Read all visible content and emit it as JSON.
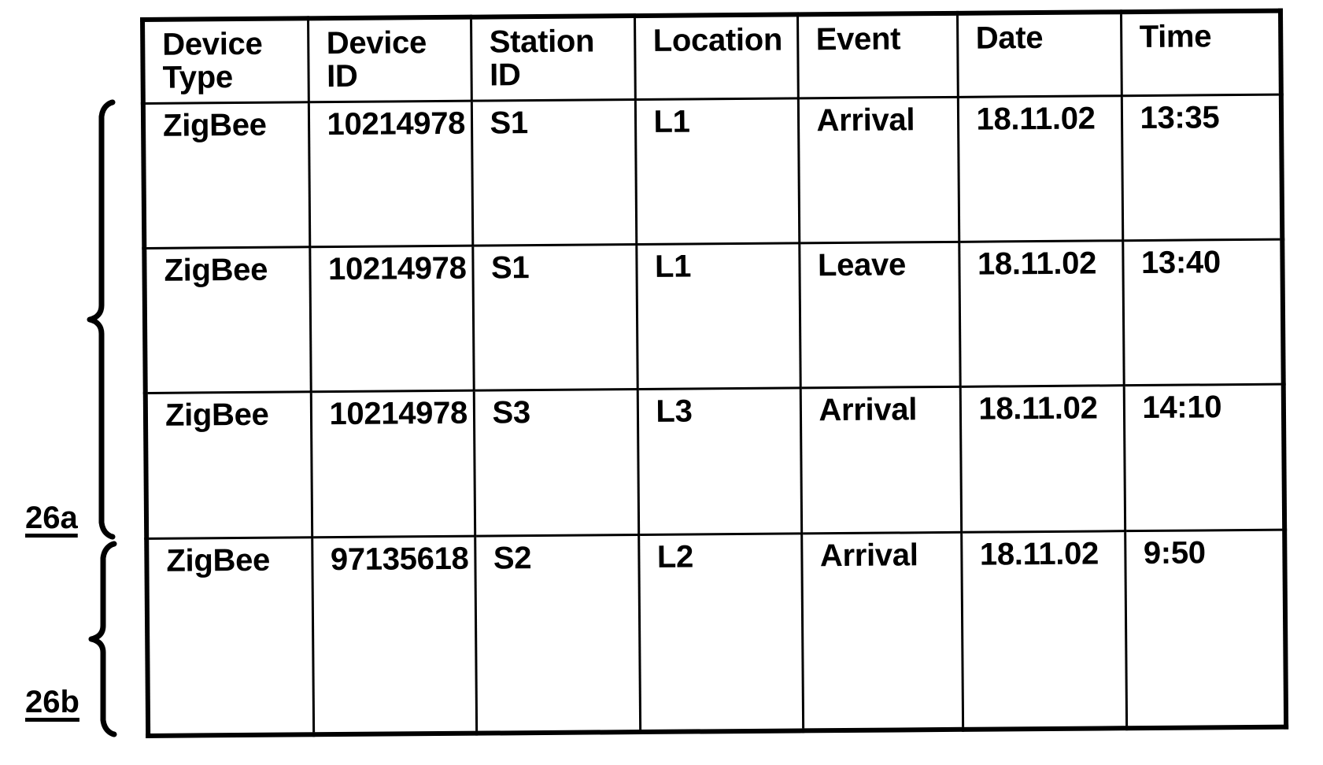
{
  "figure": {
    "caption_labels": [
      {
        "id": "26a",
        "text": "26a",
        "spans_rows": [
          0,
          1,
          2
        ]
      },
      {
        "id": "26b",
        "text": "26b",
        "spans_rows": [
          3
        ]
      }
    ]
  },
  "table": {
    "name": "device-event-log-table",
    "columns": [
      {
        "key": "device_type",
        "line1": "Device",
        "line2": "Type"
      },
      {
        "key": "device_id",
        "line1": "Device",
        "line2": "ID"
      },
      {
        "key": "station_id",
        "line1": "Station",
        "line2": "ID"
      },
      {
        "key": "location",
        "line1": "Location",
        "line2": ""
      },
      {
        "key": "event",
        "line1": "Event",
        "line2": ""
      },
      {
        "key": "date",
        "line1": "Date",
        "line2": ""
      },
      {
        "key": "time",
        "line1": "Time",
        "line2": ""
      }
    ],
    "rows": [
      {
        "device_type": "ZigBee",
        "device_id": "10214978",
        "station_id": "S1",
        "location": "L1",
        "event": "Arrival",
        "date": "18.11.02",
        "time": "13:35"
      },
      {
        "device_type": "ZigBee",
        "device_id": "10214978",
        "station_id": "S1",
        "location": "L1",
        "event": "Leave",
        "date": "18.11.02",
        "time": "13:40"
      },
      {
        "device_type": "ZigBee",
        "device_id": "10214978",
        "station_id": "S3",
        "location": "L3",
        "event": "Arrival",
        "date": "18.11.02",
        "time": "14:10"
      },
      {
        "device_type": "ZigBee",
        "device_id": "97135618",
        "station_id": "S2",
        "location": "L2",
        "event": "Arrival",
        "date": "18.11.02",
        "time": "9:50"
      }
    ]
  },
  "colors": {
    "ink": "#000000",
    "paper": "#ffffff"
  }
}
